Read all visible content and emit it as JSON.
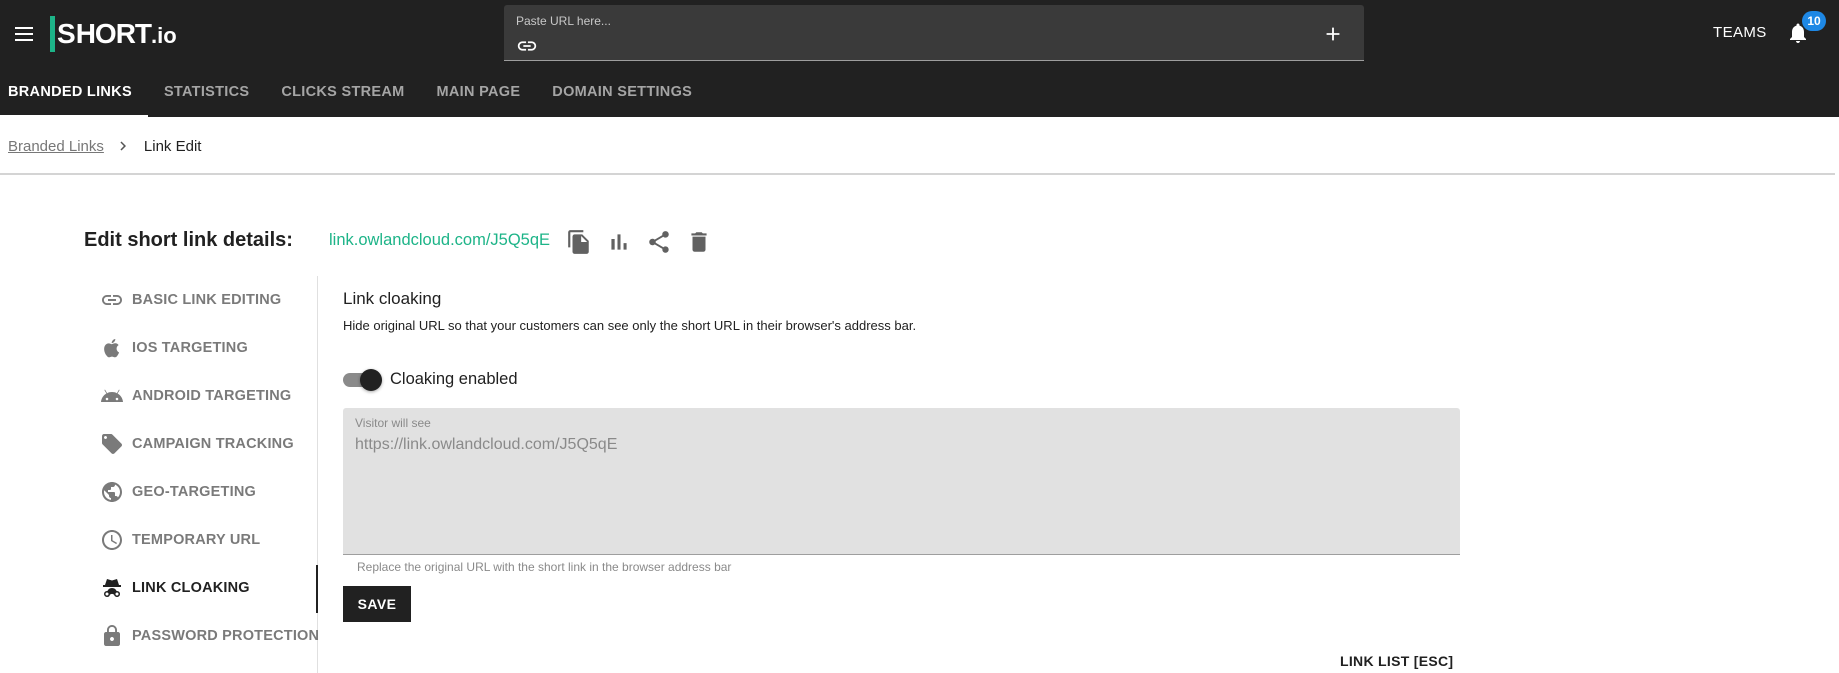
{
  "header": {
    "logo_main": "HORT",
    "logo_s": "S",
    "logo_suffix": ".io",
    "url_placeholder": "Paste URL here...",
    "teams_label": "TEAMS",
    "notification_count": "10"
  },
  "tabs": [
    {
      "label": "BRANDED LINKS",
      "active": true
    },
    {
      "label": "STATISTICS",
      "active": false
    },
    {
      "label": "CLICKS STREAM",
      "active": false
    },
    {
      "label": "MAIN PAGE",
      "active": false
    },
    {
      "label": "DOMAIN SETTINGS",
      "active": false
    }
  ],
  "breadcrumb": {
    "parent": "Branded Links",
    "current": "Link Edit"
  },
  "editor": {
    "heading": "Edit short link details:",
    "short_link": "link.owlandcloud.com/J5Q5qE",
    "actions": [
      "copy-icon",
      "stats-icon",
      "share-icon",
      "delete-icon"
    ]
  },
  "side_nav": {
    "items": [
      {
        "label": "BASIC LINK EDITING",
        "icon": "link-icon"
      },
      {
        "label": "IOS TARGETING",
        "icon": "apple-icon"
      },
      {
        "label": "ANDROID TARGETING",
        "icon": "android-icon"
      },
      {
        "label": "CAMPAIGN TRACKING",
        "icon": "tag-icon"
      },
      {
        "label": "GEO-TARGETING",
        "icon": "globe-icon"
      },
      {
        "label": "TEMPORARY URL",
        "icon": "clock-icon"
      },
      {
        "label": "LINK CLOAKING",
        "icon": "incognito-icon",
        "active": true
      },
      {
        "label": "PASSWORD PROTECTION",
        "icon": "lock-icon"
      }
    ]
  },
  "cloaking": {
    "title": "Link cloaking",
    "description": "Hide original URL so that your customers can see only the short URL in their browser's address bar.",
    "toggle_label": "Cloaking enabled",
    "toggle_on": true,
    "visitor_label": "Visitor will see",
    "visitor_value": "https://link.owlandcloud.com/J5Q5qE",
    "helper": "Replace the original URL with the short link in the browser address bar",
    "save_label": "SAVE",
    "link_list_label": "LINK LIST [ESC]"
  },
  "colors": {
    "header_bg": "#212121",
    "accent_green": "#1db488",
    "badge_blue": "#1e88e5",
    "field_bg": "#e1e1e1"
  }
}
